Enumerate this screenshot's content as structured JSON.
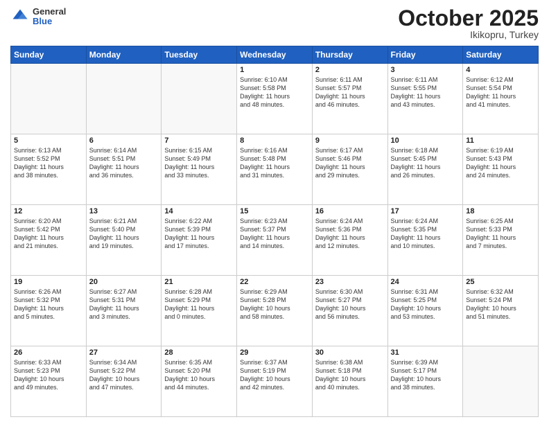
{
  "header": {
    "logo_general": "General",
    "logo_blue": "Blue",
    "month_title": "October 2025",
    "location": "Ikikopru, Turkey"
  },
  "days_of_week": [
    "Sunday",
    "Monday",
    "Tuesday",
    "Wednesday",
    "Thursday",
    "Friday",
    "Saturday"
  ],
  "weeks": [
    [
      {
        "day": "",
        "info": ""
      },
      {
        "day": "",
        "info": ""
      },
      {
        "day": "",
        "info": ""
      },
      {
        "day": "1",
        "info": "Sunrise: 6:10 AM\nSunset: 5:58 PM\nDaylight: 11 hours\nand 48 minutes."
      },
      {
        "day": "2",
        "info": "Sunrise: 6:11 AM\nSunset: 5:57 PM\nDaylight: 11 hours\nand 46 minutes."
      },
      {
        "day": "3",
        "info": "Sunrise: 6:11 AM\nSunset: 5:55 PM\nDaylight: 11 hours\nand 43 minutes."
      },
      {
        "day": "4",
        "info": "Sunrise: 6:12 AM\nSunset: 5:54 PM\nDaylight: 11 hours\nand 41 minutes."
      }
    ],
    [
      {
        "day": "5",
        "info": "Sunrise: 6:13 AM\nSunset: 5:52 PM\nDaylight: 11 hours\nand 38 minutes."
      },
      {
        "day": "6",
        "info": "Sunrise: 6:14 AM\nSunset: 5:51 PM\nDaylight: 11 hours\nand 36 minutes."
      },
      {
        "day": "7",
        "info": "Sunrise: 6:15 AM\nSunset: 5:49 PM\nDaylight: 11 hours\nand 33 minutes."
      },
      {
        "day": "8",
        "info": "Sunrise: 6:16 AM\nSunset: 5:48 PM\nDaylight: 11 hours\nand 31 minutes."
      },
      {
        "day": "9",
        "info": "Sunrise: 6:17 AM\nSunset: 5:46 PM\nDaylight: 11 hours\nand 29 minutes."
      },
      {
        "day": "10",
        "info": "Sunrise: 6:18 AM\nSunset: 5:45 PM\nDaylight: 11 hours\nand 26 minutes."
      },
      {
        "day": "11",
        "info": "Sunrise: 6:19 AM\nSunset: 5:43 PM\nDaylight: 11 hours\nand 24 minutes."
      }
    ],
    [
      {
        "day": "12",
        "info": "Sunrise: 6:20 AM\nSunset: 5:42 PM\nDaylight: 11 hours\nand 21 minutes."
      },
      {
        "day": "13",
        "info": "Sunrise: 6:21 AM\nSunset: 5:40 PM\nDaylight: 11 hours\nand 19 minutes."
      },
      {
        "day": "14",
        "info": "Sunrise: 6:22 AM\nSunset: 5:39 PM\nDaylight: 11 hours\nand 17 minutes."
      },
      {
        "day": "15",
        "info": "Sunrise: 6:23 AM\nSunset: 5:37 PM\nDaylight: 11 hours\nand 14 minutes."
      },
      {
        "day": "16",
        "info": "Sunrise: 6:24 AM\nSunset: 5:36 PM\nDaylight: 11 hours\nand 12 minutes."
      },
      {
        "day": "17",
        "info": "Sunrise: 6:24 AM\nSunset: 5:35 PM\nDaylight: 11 hours\nand 10 minutes."
      },
      {
        "day": "18",
        "info": "Sunrise: 6:25 AM\nSunset: 5:33 PM\nDaylight: 11 hours\nand 7 minutes."
      }
    ],
    [
      {
        "day": "19",
        "info": "Sunrise: 6:26 AM\nSunset: 5:32 PM\nDaylight: 11 hours\nand 5 minutes."
      },
      {
        "day": "20",
        "info": "Sunrise: 6:27 AM\nSunset: 5:31 PM\nDaylight: 11 hours\nand 3 minutes."
      },
      {
        "day": "21",
        "info": "Sunrise: 6:28 AM\nSunset: 5:29 PM\nDaylight: 11 hours\nand 0 minutes."
      },
      {
        "day": "22",
        "info": "Sunrise: 6:29 AM\nSunset: 5:28 PM\nDaylight: 10 hours\nand 58 minutes."
      },
      {
        "day": "23",
        "info": "Sunrise: 6:30 AM\nSunset: 5:27 PM\nDaylight: 10 hours\nand 56 minutes."
      },
      {
        "day": "24",
        "info": "Sunrise: 6:31 AM\nSunset: 5:25 PM\nDaylight: 10 hours\nand 53 minutes."
      },
      {
        "day": "25",
        "info": "Sunrise: 6:32 AM\nSunset: 5:24 PM\nDaylight: 10 hours\nand 51 minutes."
      }
    ],
    [
      {
        "day": "26",
        "info": "Sunrise: 6:33 AM\nSunset: 5:23 PM\nDaylight: 10 hours\nand 49 minutes."
      },
      {
        "day": "27",
        "info": "Sunrise: 6:34 AM\nSunset: 5:22 PM\nDaylight: 10 hours\nand 47 minutes."
      },
      {
        "day": "28",
        "info": "Sunrise: 6:35 AM\nSunset: 5:20 PM\nDaylight: 10 hours\nand 44 minutes."
      },
      {
        "day": "29",
        "info": "Sunrise: 6:37 AM\nSunset: 5:19 PM\nDaylight: 10 hours\nand 42 minutes."
      },
      {
        "day": "30",
        "info": "Sunrise: 6:38 AM\nSunset: 5:18 PM\nDaylight: 10 hours\nand 40 minutes."
      },
      {
        "day": "31",
        "info": "Sunrise: 6:39 AM\nSunset: 5:17 PM\nDaylight: 10 hours\nand 38 minutes."
      },
      {
        "day": "",
        "info": ""
      }
    ]
  ]
}
